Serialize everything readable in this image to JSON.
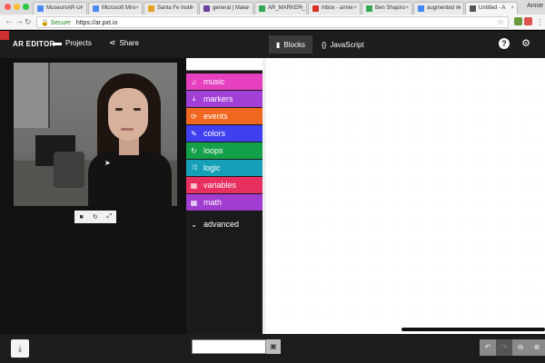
{
  "browser": {
    "tabs": [
      {
        "label": "MuseumAR-Ui",
        "color": "#4a8af4"
      },
      {
        "label": "Microsoft Mini",
        "color": "#4a8af4"
      },
      {
        "label": "Santa Fe Instit",
        "color": "#e8a020"
      },
      {
        "label": "general | Make",
        "color": "#6b3fa0"
      },
      {
        "label": "AR_MARKER_",
        "color": "#34a853"
      },
      {
        "label": "Inbox - annie",
        "color": "#d93025"
      },
      {
        "label": "Ben Shapiro",
        "color": "#34a853"
      },
      {
        "label": "augmented re",
        "color": "#4285f4"
      },
      {
        "label": "Untitled - A",
        "color": "#555555"
      }
    ],
    "profile": "Annie",
    "secure_label": "Secure",
    "url": "https://ar.pxt.io"
  },
  "header": {
    "brand": "AR EDITOR",
    "projects_label": "Projects",
    "share_label": "Share",
    "blocks_label": "Blocks",
    "javascript_label": "JavaScript"
  },
  "toolbox": {
    "categories": [
      {
        "label": "music",
        "icon": "♫",
        "color": "#e63fbf"
      },
      {
        "label": "markers",
        "icon": "⤓",
        "color": "#a23fd4"
      },
      {
        "label": "events",
        "icon": "⟳",
        "color": "#f06820"
      },
      {
        "label": "colors",
        "icon": "✎",
        "color": "#4040f0"
      },
      {
        "label": "loops",
        "icon": "↻",
        "color": "#14a048"
      },
      {
        "label": "logic",
        "icon": "⤨",
        "color": "#16a0b8"
      },
      {
        "label": "variables",
        "icon": "▦",
        "color": "#e83060"
      },
      {
        "label": "math",
        "icon": "▦",
        "color": "#a03cd0"
      }
    ],
    "advanced_label": "advanced"
  },
  "simulator": {
    "controls": [
      "■",
      "↻",
      "⤢"
    ]
  },
  "footer": {
    "project_name": ""
  }
}
